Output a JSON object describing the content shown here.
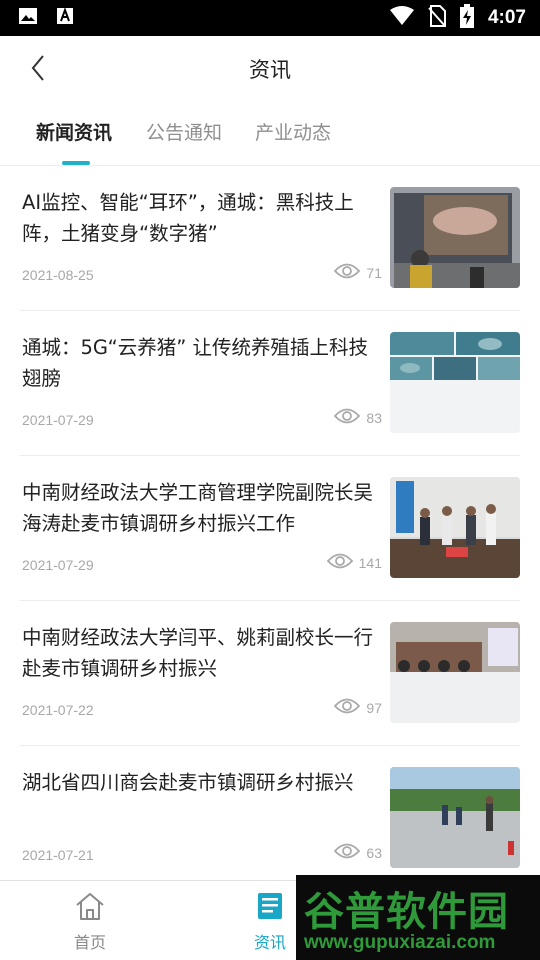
{
  "status_bar": {
    "time": "4:07",
    "icons": [
      "image-icon",
      "text-a-icon",
      "wifi-icon",
      "no-sim-icon",
      "battery-charging-icon"
    ]
  },
  "app_bar": {
    "title": "资讯",
    "back_icon": "chevron-left-icon"
  },
  "tabs": [
    {
      "label": "新闻资讯",
      "active": true
    },
    {
      "label": "公告通知",
      "active": false
    },
    {
      "label": "产业动态",
      "active": false
    }
  ],
  "accent_color": "#20b0c8",
  "news": [
    {
      "title": "AI监控、智能“耳环”，通城：黑科技上阵，土猪变身“数字猪”",
      "date": "2021-08-25",
      "views": "71"
    },
    {
      "title": "通城：5G“云养猪” 让传统养殖插上科技翅膀",
      "date": "2021-07-29",
      "views": "83"
    },
    {
      "title": "中南财经政法大学工商管理学院副院长吴海涛赴麦市镇调研乡村振兴工作",
      "date": "2021-07-29",
      "views": "141"
    },
    {
      "title": "中南财经政法大学闫平、姚莉副校长一行 赴麦市镇调研乡村振兴",
      "date": "2021-07-22",
      "views": "97"
    },
    {
      "title": "湖北省四川商会赴麦市镇调研乡村振兴",
      "date": "2021-07-21",
      "views": "63"
    }
  ],
  "bottom_nav": [
    {
      "label": "首页",
      "icon": "home-icon",
      "active": false
    },
    {
      "label": "资讯",
      "icon": "news-icon",
      "active": true
    }
  ],
  "watermark": {
    "logo": "谷普软件园",
    "url": "www.gupuxiazai.com"
  }
}
